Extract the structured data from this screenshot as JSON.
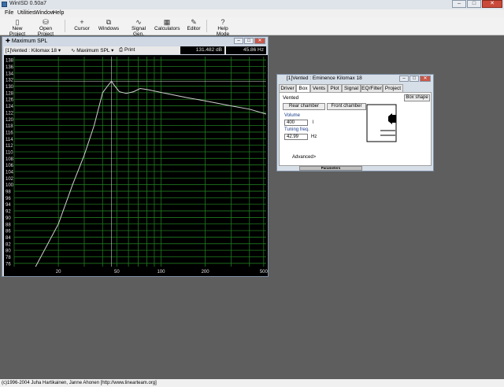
{
  "app": {
    "title": "WinISD 0.50a7"
  },
  "window_controls": {
    "minimize": "–",
    "maximize": "□",
    "close": "✕"
  },
  "menu": [
    "File",
    "Utilities",
    "Window",
    "Help"
  ],
  "toolbar": [
    {
      "label": "New Project",
      "icon": "new-project-icon"
    },
    {
      "label": "Open Project",
      "icon": "open-project-icon"
    },
    {
      "label": "Cursor",
      "icon": "cursor-icon"
    },
    {
      "label": "Windows",
      "icon": "windows-icon"
    },
    {
      "label": "Signal Gen.",
      "icon": "signal-gen-icon"
    },
    {
      "label": "Calculators",
      "icon": "calculators-icon"
    },
    {
      "label": "Editor",
      "icon": "editor-icon"
    },
    {
      "label": "Help Mode",
      "icon": "help-mode-icon"
    }
  ],
  "spl_window": {
    "title": "Maximum SPL",
    "project_select": "[1]Vented : Kilomax 18",
    "plot_select": "Maximum SPL",
    "print_label": "Print",
    "readout_db": "131.482 dB",
    "readout_hz": "45.86 Hz"
  },
  "chart_data": {
    "type": "line",
    "x_scale": "log",
    "xlim": [
      10,
      520
    ],
    "ylim": [
      75,
      139
    ],
    "x_ticks": [
      20,
      50,
      100,
      200,
      500
    ],
    "y_ticks": [
      76,
      78,
      80,
      82,
      84,
      86,
      88,
      90,
      92,
      94,
      96,
      98,
      100,
      102,
      104,
      106,
      108,
      110,
      112,
      114,
      116,
      118,
      120,
      122,
      124,
      126,
      128,
      130,
      132,
      134,
      136,
      138
    ],
    "grid": true,
    "background": "#000000",
    "grid_color": "#1f7a1f",
    "line_color": "#d0d0d0",
    "cursor": {
      "x": 45.86,
      "y": 131.482
    },
    "series": [
      {
        "x": [
          14,
          20,
          25,
          30,
          35,
          40,
          44,
          46,
          48,
          52,
          58,
          65,
          72,
          80,
          100,
          150,
          200,
          300,
          400,
          520
        ],
        "y": [
          75,
          88,
          100,
          109,
          118,
          128,
          130.5,
          131.5,
          130.3,
          128.3,
          127.8,
          128.3,
          129.3,
          129.0,
          128.1,
          126.5,
          125.5,
          124.0,
          123.0,
          121.5
        ]
      }
    ]
  },
  "box_window": {
    "title": "[1]Vented : Eminence  Kilomax 18",
    "tabs": [
      "Driver",
      "Box",
      "Vents",
      "Plot",
      "Signal",
      "EQ/Filter",
      "Project"
    ],
    "active_tab": "Box",
    "box_type": "Vented",
    "box_shape_button": "Box shape",
    "rear_chamber_button": "Rear chamber",
    "front_chamber_button": "Front chamber",
    "volume_label": "Volume",
    "volume_value": "400",
    "volume_unit": "l",
    "tuning_label": "Tuning freq.",
    "tuning_value": "42.99",
    "tuning_unit": "Hz",
    "advanced_button": "Advanced>",
    "parameters_label": "Parameters"
  },
  "status": {
    "text": "(c)1996-2004 Juha Hartikainen, Janne Ahonen [http://www.linearteam.org]"
  }
}
